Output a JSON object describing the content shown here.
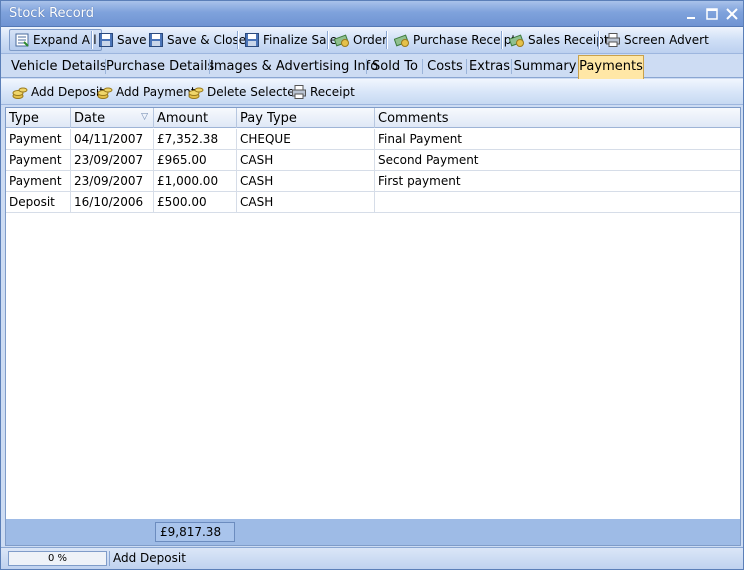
{
  "window": {
    "title": "Stock Record"
  },
  "toolbar": {
    "expand_all": "Expand All",
    "save": "Save",
    "save_close": "Save & Close",
    "finalize_sale": "Finalize Sale",
    "order": "Order",
    "purchase_receipt": "Purchase Receipt",
    "sales_receipt": "Sales Receipt",
    "screen_advert": "Screen Advert"
  },
  "tabs": [
    {
      "label": "Vehicle Details"
    },
    {
      "label": "Purchase Details"
    },
    {
      "label": "Images & Advertising Info"
    },
    {
      "label": "Sold To"
    },
    {
      "label": "Costs"
    },
    {
      "label": "Extras"
    },
    {
      "label": "Summary"
    },
    {
      "label": "Payments",
      "active": true
    }
  ],
  "subtoolbar": {
    "add_deposit": "Add Deposit",
    "add_payment": "Add Payment",
    "delete_selected": "Delete Selected",
    "receipt": "Receipt"
  },
  "grid": {
    "columns": [
      "Type",
      "Date",
      "Amount",
      "Pay Type",
      "Comments"
    ],
    "sort_indicator": "▽",
    "rows": [
      [
        "Payment",
        "04/11/2007",
        "£7,352.38",
        "CHEQUE",
        "Final Payment"
      ],
      [
        "Payment",
        "23/09/2007",
        "£965.00",
        "CASH",
        "Second Payment"
      ],
      [
        "Payment",
        "23/09/2007",
        "£1,000.00",
        "CASH",
        "First payment"
      ],
      [
        "Deposit",
        "16/10/2006",
        "£500.00",
        "CASH",
        ""
      ]
    ],
    "total": "£9,817.38"
  },
  "status": {
    "progress_text": "0 %",
    "progress_value": 0,
    "message": "Add Deposit"
  },
  "colors": {
    "title_bar": "#7fa2dc",
    "active_tab": "#ffe7a6",
    "footer": "#9ebbe6"
  }
}
